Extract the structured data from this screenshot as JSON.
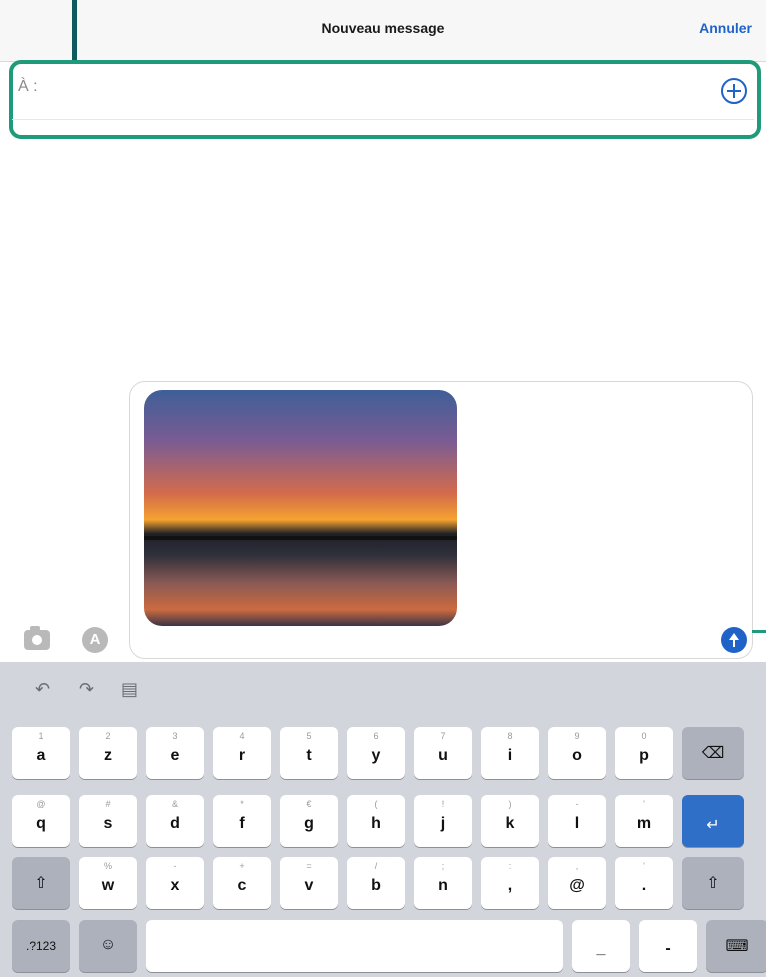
{
  "header": {
    "title": "Nouveau message",
    "cancel_label": "Annuler"
  },
  "recipient": {
    "label": "À :",
    "value": ""
  },
  "keyboard": {
    "tools": [
      "undo-icon",
      "redo-icon",
      "paste-icon"
    ],
    "row1": [
      {
        "alt": "1",
        "main": "a"
      },
      {
        "alt": "2",
        "main": "z"
      },
      {
        "alt": "3",
        "main": "e"
      },
      {
        "alt": "4",
        "main": "r"
      },
      {
        "alt": "5",
        "main": "t"
      },
      {
        "alt": "6",
        "main": "y"
      },
      {
        "alt": "7",
        "main": "u"
      },
      {
        "alt": "8",
        "main": "i"
      },
      {
        "alt": "9",
        "main": "o"
      },
      {
        "alt": "0",
        "main": "p"
      }
    ],
    "row2": [
      {
        "alt": "@",
        "main": "q"
      },
      {
        "alt": "#",
        "main": "s"
      },
      {
        "alt": "&",
        "main": "d"
      },
      {
        "alt": "*",
        "main": "f"
      },
      {
        "alt": "€",
        "main": "g"
      },
      {
        "alt": "(",
        "main": "h"
      },
      {
        "alt": "!",
        "main": "j"
      },
      {
        "alt": ")",
        "main": "k"
      },
      {
        "alt": "-",
        "main": "l"
      },
      {
        "alt": "'",
        "main": "m"
      }
    ],
    "row3": [
      {
        "alt": "%",
        "main": "w"
      },
      {
        "alt": "-",
        "main": "x"
      },
      {
        "alt": "+",
        "main": "c"
      },
      {
        "alt": "=",
        "main": "v"
      },
      {
        "alt": "/",
        "main": "b"
      },
      {
        "alt": ";",
        "main": "n"
      },
      {
        "alt": ":",
        "main": ","
      },
      {
        "alt": ",",
        "main": "@"
      },
      {
        "alt": "'",
        "main": "."
      }
    ],
    "bottom": {
      "numbers_label": ".?123",
      "emoji": "emoji-icon",
      "space_label": "",
      "underscore": "_",
      "dash": "-"
    }
  }
}
